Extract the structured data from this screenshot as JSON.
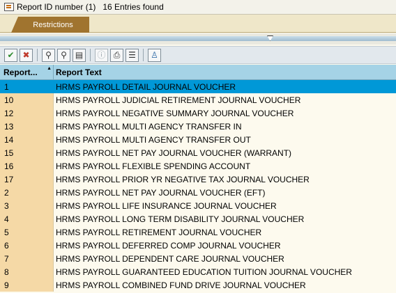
{
  "window": {
    "title": "Report ID number (1)   16 Entries found"
  },
  "tabs": [
    {
      "label": "Restrictions"
    }
  ],
  "toolbar": {
    "buttons": [
      {
        "name": "ok-button",
        "icon": "check-icon",
        "glyph": "✔",
        "color": "#2d8a2d"
      },
      {
        "name": "cancel-button",
        "icon": "cancel-x-icon",
        "glyph": "✖",
        "color": "#c0392b"
      },
      {
        "name": "find-button",
        "icon": "binoculars-icon",
        "glyph": "⚲",
        "color": "#333333"
      },
      {
        "name": "find-next-button",
        "icon": "binoculars-plus-icon",
        "glyph": "⚲",
        "color": "#333333"
      },
      {
        "name": "filter-button",
        "icon": "filter-icon",
        "glyph": "▤",
        "color": "#333333"
      },
      {
        "name": "info-button",
        "icon": "info-icon",
        "glyph": "ⓘ",
        "color": "#9aa6ad",
        "disabled": true
      },
      {
        "name": "print-button",
        "icon": "printer-icon",
        "glyph": "⎙",
        "color": "#333333"
      },
      {
        "name": "list-button",
        "icon": "list-icon",
        "glyph": "☰",
        "color": "#333333"
      },
      {
        "name": "personal-list-button",
        "icon": "user-list-icon",
        "glyph": "♙",
        "color": "#1f5fa0"
      }
    ]
  },
  "table": {
    "columns": [
      "Report...",
      "Report Text"
    ],
    "selected_index": 0,
    "rows": [
      {
        "id": "1",
        "text": "HRMS PAYROLL DETAIL JOURNAL VOUCHER"
      },
      {
        "id": "10",
        "text": "HRMS PAYROLL JUDICIAL RETIREMENT JOURNAL VOUCHER"
      },
      {
        "id": "12",
        "text": "HRMS PAYROLL NEGATIVE SUMMARY JOURNAL VOUCHER"
      },
      {
        "id": "13",
        "text": "HRMS PAYROLL MULTI AGENCY TRANSFER IN"
      },
      {
        "id": "14",
        "text": "HRMS PAYROLL MULTI AGENCY TRANSFER OUT"
      },
      {
        "id": "15",
        "text": "HRMS PAYROLL NET PAY JOURNAL VOUCHER (WARRANT)"
      },
      {
        "id": "16",
        "text": "HRMS PAYROLL FLEXIBLE SPENDING ACCOUNT"
      },
      {
        "id": "17",
        "text": "HRMS PAYROLL PRIOR YR NEGATIVE TAX JOURNAL VOUCHER"
      },
      {
        "id": "2",
        "text": "HRMS PAYROLL NET PAY JOURNAL VOUCHER (EFT)"
      },
      {
        "id": "3",
        "text": "HRMS PAYROLL LIFE INSURANCE JOURNAL VOUCHER"
      },
      {
        "id": "4",
        "text": "HRMS PAYROLL LONG TERM DISABILITY JOURNAL VOUCHER"
      },
      {
        "id": "5",
        "text": "HRMS PAYROLL RETIREMENT JOURNAL VOUCHER"
      },
      {
        "id": "6",
        "text": "HRMS PAYROLL DEFERRED COMP JOURNAL VOUCHER"
      },
      {
        "id": "7",
        "text": "HRMS PAYROLL DEPENDENT CARE JOURNAL VOUCHER"
      },
      {
        "id": "8",
        "text": "HRMS PAYROLL GUARANTEED EDUCATION TUITION JOURNAL VOUCHER"
      },
      {
        "id": "9",
        "text": "HRMS PAYROLL COMBINED FUND DRIVE JOURNAL VOUCHER"
      }
    ]
  }
}
